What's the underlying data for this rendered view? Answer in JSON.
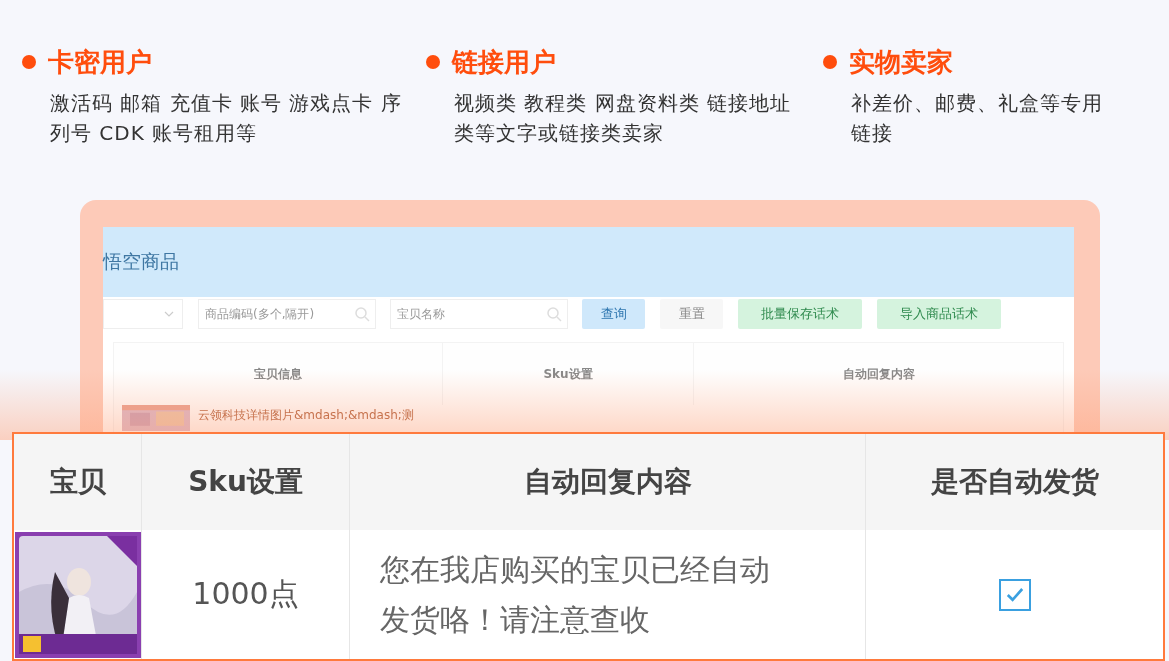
{
  "categories": [
    {
      "title": "卡密用户",
      "description": "激活码 邮箱 充值卡 账号 游戏点卡 序列号 CDK 账号租用等"
    },
    {
      "title": "链接用户",
      "description": "视频类 教程类 网盘资料类 链接地址类等文字或链接类卖家"
    },
    {
      "title": "实物卖家",
      "description": "补差价、邮费、礼盒等专用链接"
    }
  ],
  "preview": {
    "title": "悟空商品",
    "filters": [
      {
        "kind": "select"
      },
      {
        "kind": "search",
        "placeholder": "商品编码(多个,隔开)"
      },
      {
        "kind": "search",
        "placeholder": "宝贝名称"
      }
    ],
    "buttons": [
      {
        "label": "查询",
        "kind": "primary"
      },
      {
        "label": "重置",
        "kind": "default"
      },
      {
        "label": "批量保存话术",
        "kind": "success"
      },
      {
        "label": "导入商品话术",
        "kind": "success"
      }
    ],
    "columns": [
      "宝贝信息",
      "Sku设置",
      "自动回复内容"
    ],
    "row": {
      "title": "云领科技详情图片&mdash;&mdash;测"
    }
  },
  "table": {
    "columns": [
      "宝贝",
      "Sku设置",
      "自动回复内容",
      "是否自动发货"
    ],
    "rows": [
      {
        "sku": "1000点",
        "reply": "您在我店购买的宝贝已经自动发货咯！请注意查收",
        "auto_ship": true
      }
    ]
  }
}
